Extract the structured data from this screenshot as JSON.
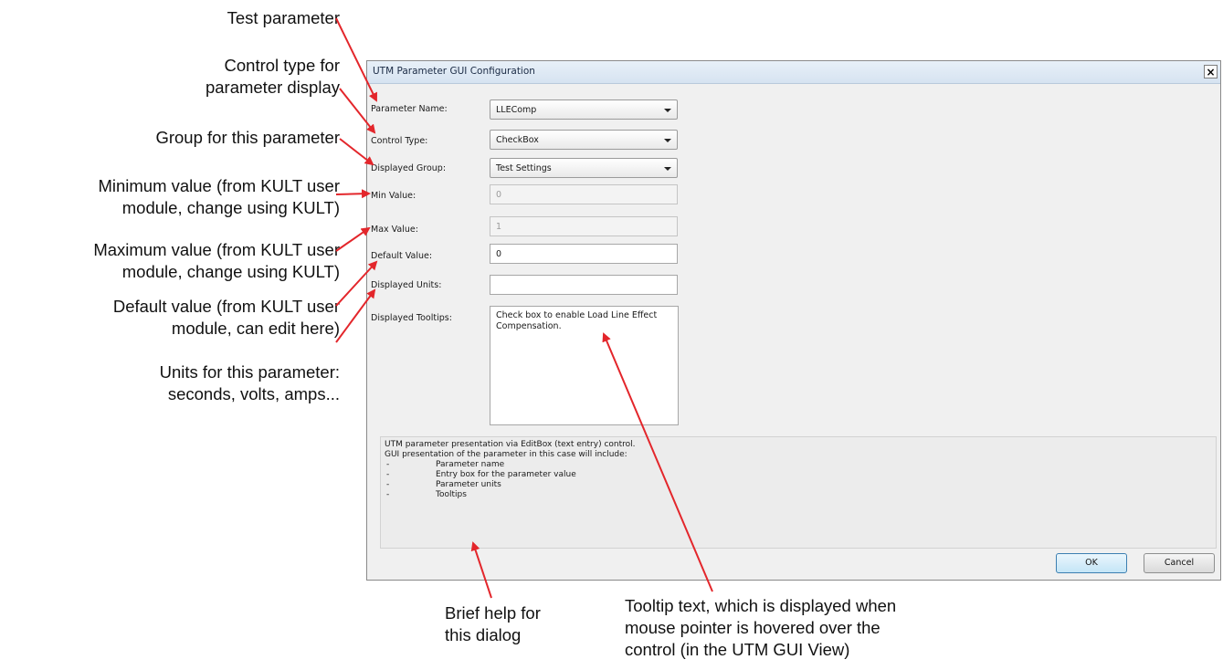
{
  "callouts": {
    "test_parameter": [
      "Test parameter"
    ],
    "control_type": [
      "Control type for",
      "parameter display"
    ],
    "group": [
      "Group for this parameter"
    ],
    "min_value": [
      "Minimum value (from KULT user",
      "module, change using KULT)"
    ],
    "max_value": [
      "Maximum value (from KULT user",
      "module, change using KULT)"
    ],
    "default_value": [
      "Default value (from KULT user",
      "module, can edit here)"
    ],
    "units": [
      "Units for this parameter:",
      "seconds, volts, amps..."
    ],
    "brief_help": [
      "Brief help for",
      "this dialog"
    ],
    "tooltip_text": [
      "Tooltip text, which is displayed when",
      "mouse pointer is hovered over the",
      "control (in the UTM GUI View)"
    ]
  },
  "dialog": {
    "title": "UTM Parameter GUI Configuration",
    "close_label": "×",
    "fields": {
      "parameter_name": {
        "label": "Parameter Name:",
        "value": "LLEComp"
      },
      "control_type": {
        "label": "Control Type:",
        "value": "CheckBox"
      },
      "displayed_group": {
        "label": "Displayed Group:",
        "value": "Test Settings"
      },
      "min_value": {
        "label": "Min Value:",
        "value": "0"
      },
      "max_value": {
        "label": "Max Value:",
        "value": "1"
      },
      "default_value": {
        "label": "Default Value:",
        "value": "0"
      },
      "displayed_units": {
        "label": "Displayed Units:",
        "value": ""
      },
      "displayed_tooltips": {
        "label": "Displayed Tooltips:",
        "value": "Check box to enable Load Line Effect Compensation."
      }
    },
    "help": {
      "lines": [
        "UTM parameter presentation via EditBox (text entry) control.",
        "GUI presentation of the parameter in this case will include:"
      ],
      "items": [
        {
          "dash": "-",
          "text": "Parameter name"
        },
        {
          "dash": "-",
          "text": "Entry box for the parameter value"
        },
        {
          "dash": "-",
          "text": "Parameter units"
        },
        {
          "dash": "-",
          "text": "Tooltips"
        }
      ]
    },
    "buttons": {
      "ok": "OK",
      "cancel": "Cancel"
    }
  },
  "colors": {
    "arrow": "#e3262b",
    "titlebar": "#d6e3f1",
    "dialog_bg": "#f0f0f0"
  }
}
